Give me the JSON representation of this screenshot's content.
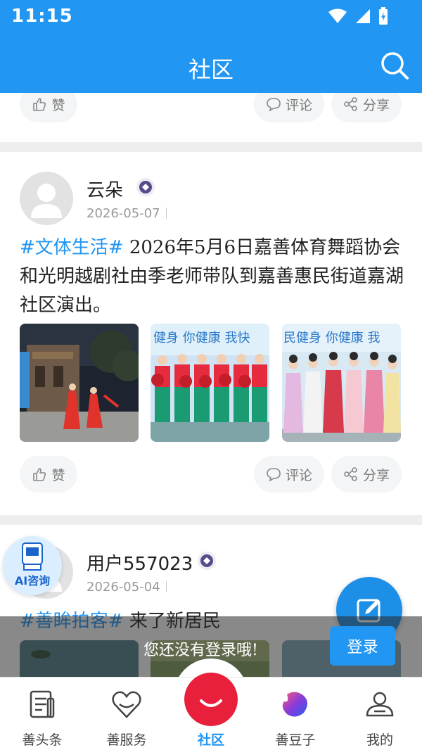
{
  "status_bar": {
    "time": "11:15"
  },
  "header": {
    "title": "社区"
  },
  "actions": {
    "like": "赞",
    "comment": "评论",
    "share": "分享"
  },
  "posts": [
    {
      "author": "云朵",
      "date": "2026-05-07",
      "tag": "#文体生活#",
      "text": " 2026年5月6日嘉善体育舞蹈协会和光明越剧社由季老师带队到嘉善惠民街道嘉湖社区演出。",
      "images": [
        "dance-performance-night",
        "fan-dance-group",
        "yue-opera-costumes"
      ]
    },
    {
      "author": "用户557023",
      "date": "2026-05-04",
      "tag": "#善眸拍客#",
      "text": " 来了新居民",
      "images": [
        "pond-photo",
        "grass-photo",
        "water-photo"
      ]
    }
  ],
  "ai_assistant": {
    "label": "AI咨询"
  },
  "login_prompt": {
    "message": "您还没有登录哦!",
    "button": "登录"
  },
  "tabs": [
    {
      "label": "善头条",
      "icon": "news-icon"
    },
    {
      "label": "善服务",
      "icon": "heart-service-icon"
    },
    {
      "label": "社区",
      "icon": "community-smile-icon",
      "active": true
    },
    {
      "label": "善豆子",
      "icon": "bean-icon"
    },
    {
      "label": "我的",
      "icon": "profile-icon"
    }
  ],
  "colors": {
    "primary": "#2196f3",
    "accent_red": "#e8203c",
    "bg_separator": "#eeeeee"
  }
}
